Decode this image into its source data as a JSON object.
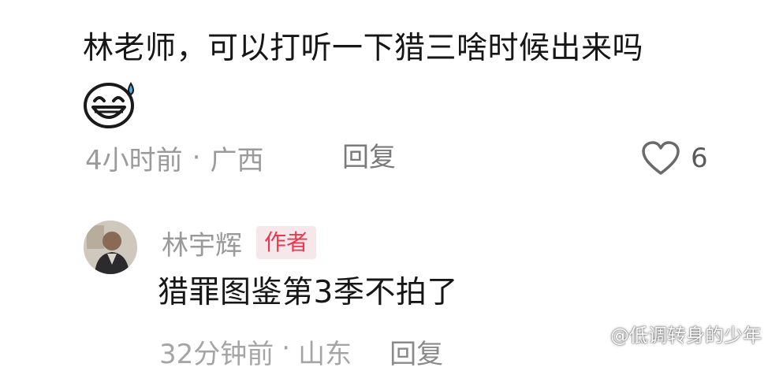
{
  "comment": {
    "text": "林老师，可以打听一下猎三啥时候出来吗",
    "emoji": "grinning-sweat-emoji",
    "time": "4小时前",
    "separator": "·",
    "location": "广西",
    "reply_label": "回复",
    "like_count": "6"
  },
  "reply": {
    "author": "林宇辉",
    "badge": "作者",
    "text": "猎罪图鉴第3季不拍了",
    "time": "32分钟前",
    "separator": "·",
    "location": "山东",
    "reply_label": "回复"
  },
  "watermark": {
    "text": "@低调转身的少年",
    "icon": "weibo-icon"
  },
  "colors": {
    "text_primary": "#161616",
    "text_meta": "#9a9a9a",
    "badge_text": "#e8394f",
    "badge_bg": "#f5e7ea"
  }
}
